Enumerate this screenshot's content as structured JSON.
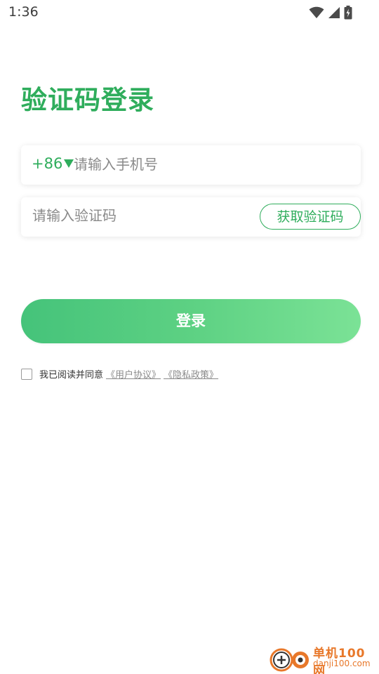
{
  "status_bar": {
    "time": "1:36",
    "icons": [
      "wifi-icon",
      "cell-signal-icon",
      "battery-charging-icon"
    ]
  },
  "title": "验证码登录",
  "phone": {
    "country_code": "+86",
    "placeholder": "请输入手机号",
    "value": ""
  },
  "code": {
    "placeholder": "请输入验证码",
    "value": "",
    "get_code_label": "获取验证码"
  },
  "login_label": "登录",
  "agreement": {
    "checked": false,
    "text": "我已阅读并同意",
    "user_agreement": "《用户协议》",
    "privacy_policy": "《隐私政策》"
  },
  "watermark": {
    "name": "单机100网",
    "domain": "danji100.com"
  },
  "colors": {
    "accent": "#2fad5c",
    "button_gradient_start": "#45c37a",
    "button_gradient_end": "#7be296",
    "watermark": "#e8782a"
  }
}
